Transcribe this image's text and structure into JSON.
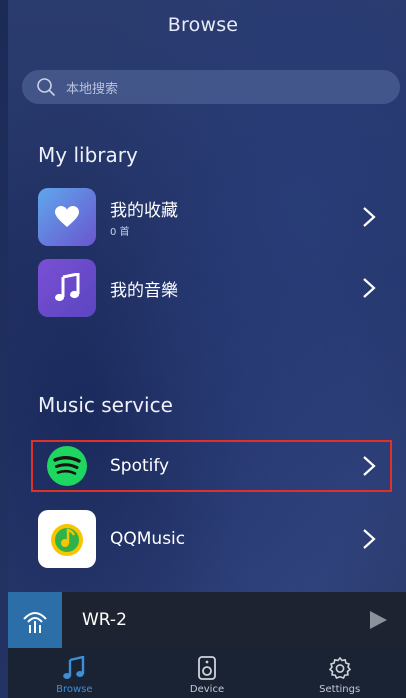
{
  "header": {
    "title": "Browse"
  },
  "search": {
    "placeholder": "本地搜索",
    "icon": "search-icon"
  },
  "library": {
    "heading": "My library",
    "items": [
      {
        "label": "我的收藏",
        "sub": "0 首",
        "icon": "heart-icon",
        "color": "#5b8fe0"
      },
      {
        "label": "我的音樂",
        "icon": "music-note-icon",
        "color": "#6a4fc8"
      }
    ]
  },
  "services": {
    "heading": "Music service",
    "items": [
      {
        "label": "Spotify",
        "icon": "spotify-icon",
        "color": "#1ed760",
        "highlighted": true,
        "highlight_color": "#e0302a"
      },
      {
        "label": "QQMusic",
        "icon": "qqmusic-icon",
        "color": "#f5c400"
      }
    ]
  },
  "player": {
    "device_name": "WR-2",
    "icon": "wifi-speaker-icon",
    "play_icon": "play-icon"
  },
  "tabs": [
    {
      "label": "Browse",
      "icon": "music-note-icon",
      "active": true
    },
    {
      "label": "Device",
      "icon": "speaker-icon",
      "active": false
    },
    {
      "label": "Settings",
      "icon": "gear-icon",
      "active": false
    }
  ],
  "colors": {
    "accent": "#3f8fd6"
  }
}
